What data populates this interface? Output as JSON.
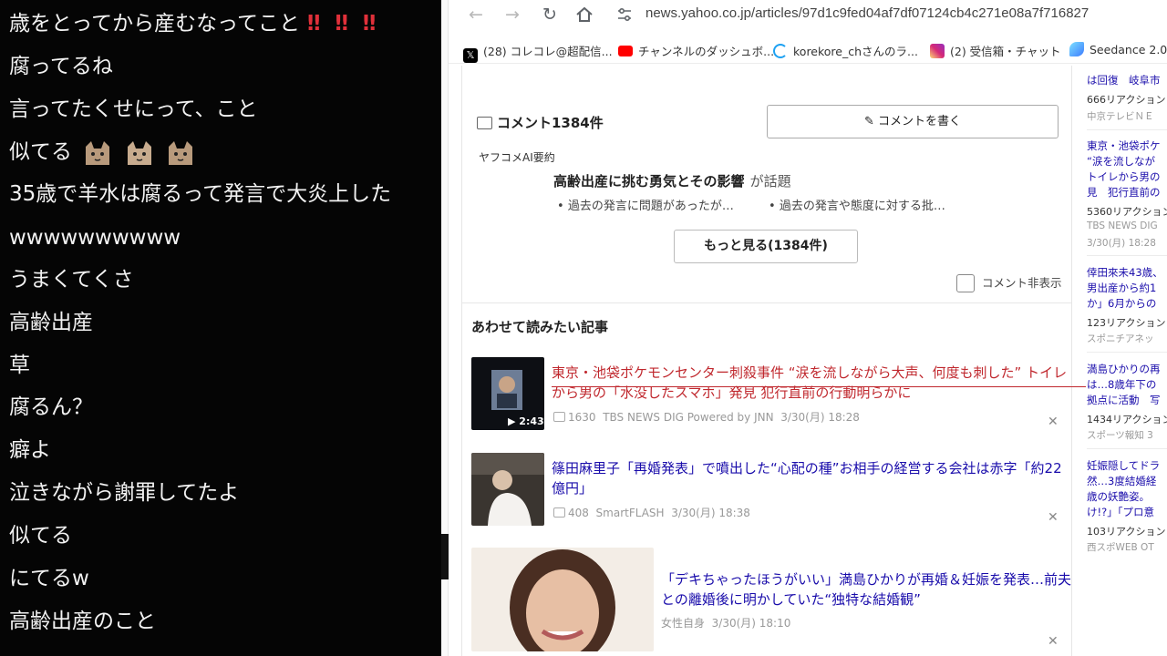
{
  "chat": {
    "lines": [
      "歳をとってから産むなってこと",
      "腐ってるね",
      "言ってたくせにって、こと",
      "似てる",
      "35歳で羊水は腐るって発言で大炎上した",
      "wwwwwwwwww",
      "うまくてくさ",
      "高齢出産",
      "草",
      "腐るん？",
      "癖よ",
      "泣きながら謝罪してたよ",
      "似てる",
      "にてるw",
      "高齢出産のこと"
    ],
    "bangs": "‼ ‼ ‼"
  },
  "browser": {
    "url": "news.yahoo.co.jp/articles/97d1c9fed04af7df07124cb4c271e08a7f716827",
    "bookmarks": [
      {
        "label": "(28) コレコレ@超配信...",
        "icon": "x-icon",
        "color": "#000000"
      },
      {
        "label": "チャンネルのダッシュボ...",
        "icon": "youtube-icon",
        "color": "#ff0000"
      },
      {
        "label": "korekore_chさんのラ...",
        "icon": "open-icon",
        "color": "#1da1f2"
      },
      {
        "label": "(2) 受信箱・チャット",
        "icon": "instagram-icon",
        "color": "#d6249f"
      },
      {
        "label": "Seedance 2.0",
        "icon": "seedance-icon",
        "color": "#3bb9ff"
      }
    ]
  },
  "comments": {
    "header": "コメント1384件",
    "write_button": "コメントを書く",
    "ai_label": "ヤフコメAI要約",
    "topic": "高齢出産に挑む勇気とその影響",
    "topic_suffix": "が話題",
    "bullets": [
      "過去の発言に問題があったが…",
      "過去の発言や態度に対する批…"
    ],
    "more_button": "もっと見る(1384件)",
    "hide_label": "コメント非表示"
  },
  "related": {
    "title": "あわせて読みたい記事",
    "articles": [
      {
        "title": "東京・池袋ポケモンセンター刺殺事件 “涙を流しながら大声、何度も刺した” トイレから男の「水没したスマホ」発見 犯行直前の行動明らかに",
        "count": "1630",
        "source": "TBS NEWS DIG Powered by JNN",
        "date": "3/30(月) 18:28",
        "duration": "▶ 2:43"
      },
      {
        "title": "篠田麻里子「再婚発表」で噴出した“心配の種”お相手の経営する会社は赤字「約22億円」",
        "count": "408",
        "source": "SmartFLASH",
        "date": "3/30(月) 18:38"
      },
      {
        "title": "「デキちゃったほうがいい」満島ひかりが再婚＆妊娠を発表…前夫との離婚後に明かしていた“独特な結婚観”",
        "source": "女性自身",
        "date": "3/30(月) 18:10"
      }
    ]
  },
  "sidebar": {
    "items": [
      {
        "title": "は回復　岐阜市",
        "react": "666リアクション",
        "src": "中京テレビＮＥ"
      },
      {
        "title": "東京・池袋ポケ",
        "title2": "“涙を流しなが",
        "title3": "トイレから男の",
        "title4": "見　犯行直前の",
        "react": "5360リアクション",
        "src": "TBS NEWS DIG",
        "date": "3/30(月) 18:28"
      },
      {
        "title": "倖田來未43歳、",
        "title2": "男出産から約1",
        "title3": "か」6月からの",
        "react": "123リアクション",
        "src": "スポニチアネッ"
      },
      {
        "title": "満島ひかりの再",
        "title2": "は…8歳年下の",
        "title3": "拠点に活動　写",
        "react": "1434リアクション",
        "src": "スポーツ報知 3"
      },
      {
        "title": "妊娠隠してドラ",
        "title2": "然…3度結婚経",
        "title3": "歳の妖艶姿。",
        "title4": "け!?」「プロ意",
        "react": "103リアクション",
        "src": "西スポWEB OT"
      }
    ]
  }
}
